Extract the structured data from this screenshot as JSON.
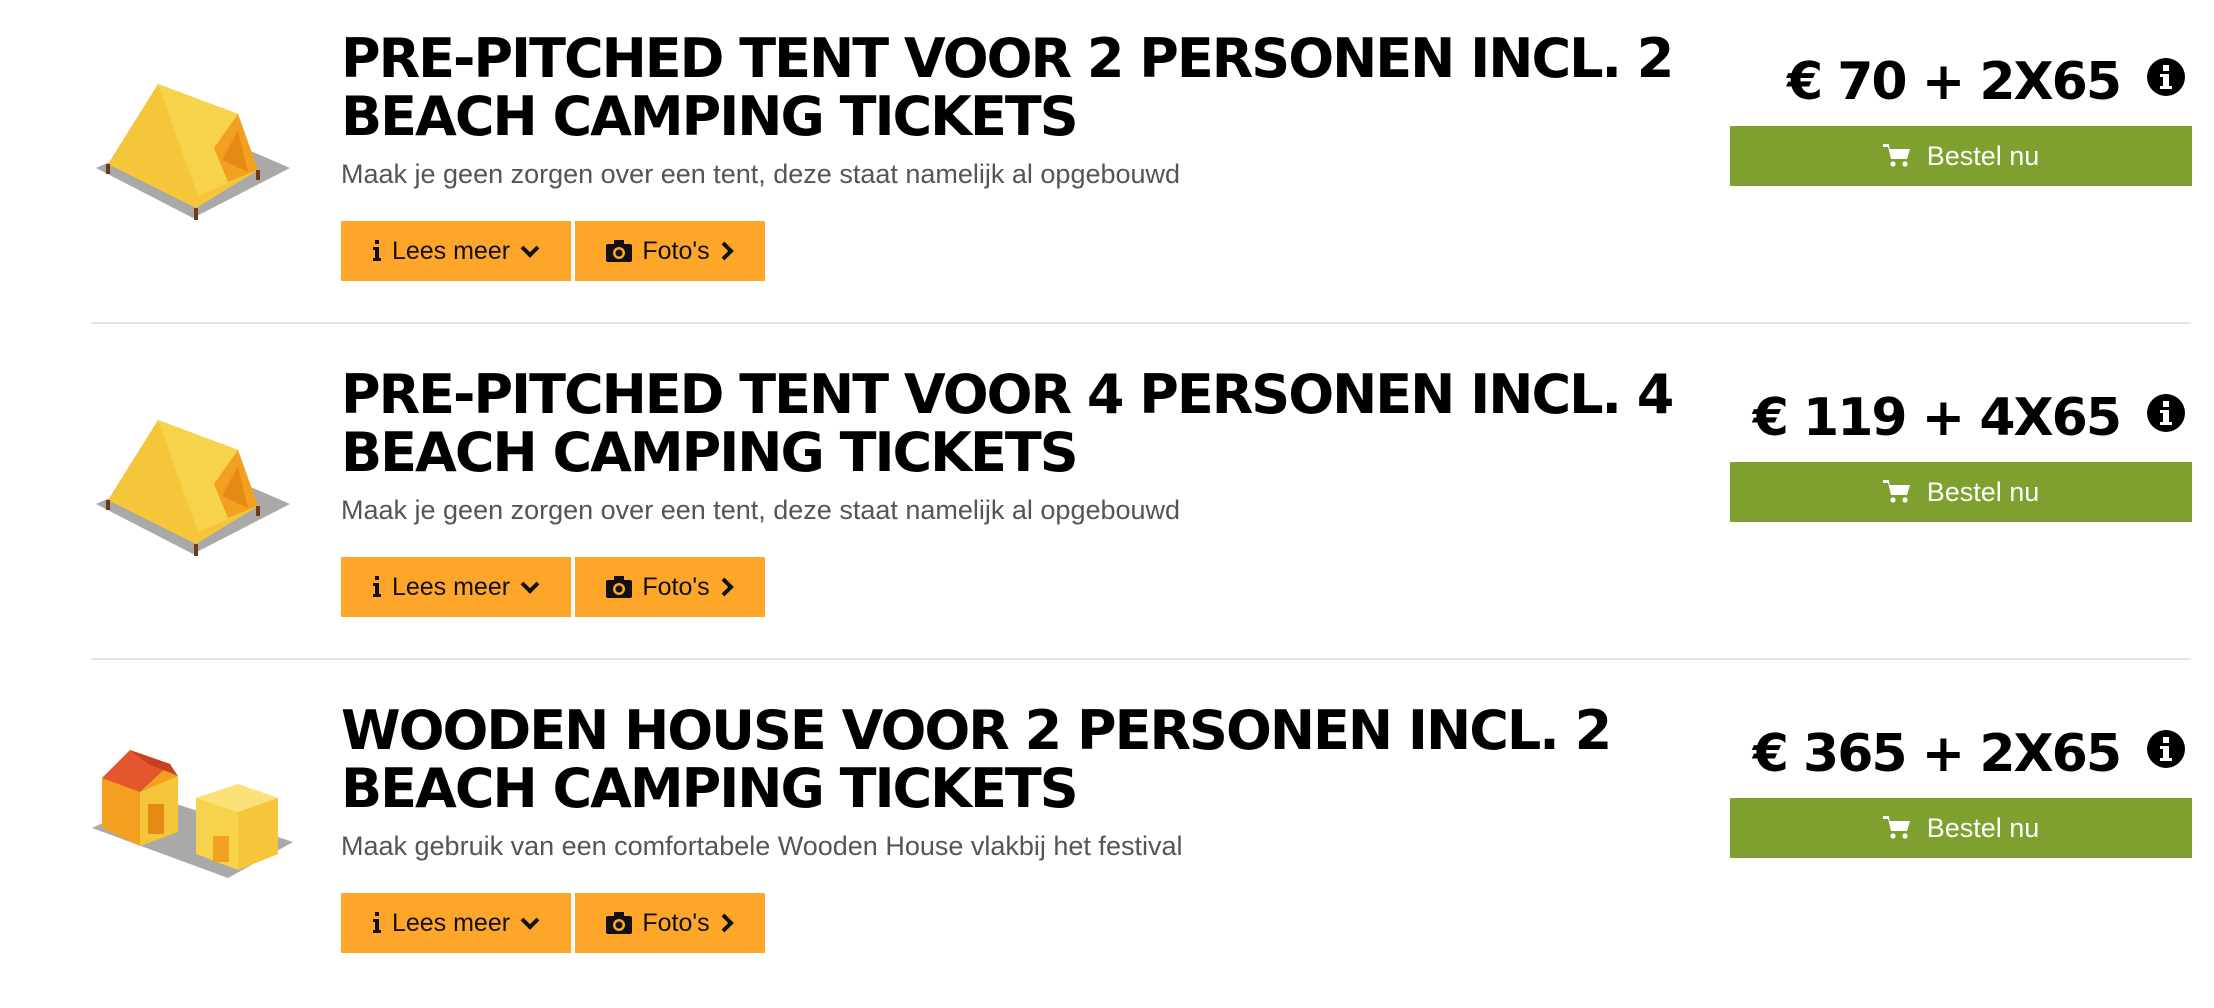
{
  "colors": {
    "accent_orange": "#fea629",
    "order_green": "#7ea02f",
    "separator": "#e2e2e2"
  },
  "products": [
    {
      "title": "PRE-PITCHED TENT VOOR 2 PERSONEN INCL. 2 BEACH CAMPING TICKETS",
      "description": "Maak je geen zorgen over een tent, deze staat namelijk al opgebouwd",
      "price": "€ 70 + 2X65",
      "read_more_label": "Lees meer",
      "photos_label": "Foto's",
      "order_label": "Bestel nu",
      "image_icon": "tent-icon"
    },
    {
      "title": "PRE-PITCHED TENT VOOR 4 PERSONEN INCL. 4 BEACH CAMPING TICKETS",
      "description": "Maak je geen zorgen over een tent, deze staat namelijk al opgebouwd",
      "price": "€ 119 + 4X65",
      "read_more_label": "Lees meer",
      "photos_label": "Foto's",
      "order_label": "Bestel nu",
      "image_icon": "tent-icon"
    },
    {
      "title": "WOODEN HOUSE VOOR 2 PERSONEN INCL. 2 BEACH CAMPING TICKETS",
      "description": "Maak gebruik van een comfortabele Wooden House vlakbij het festival",
      "price": "€ 365 + 2X65",
      "read_more_label": "Lees meer",
      "photos_label": "Foto's",
      "order_label": "Bestel nu",
      "image_icon": "wooden-house-icon"
    }
  ]
}
